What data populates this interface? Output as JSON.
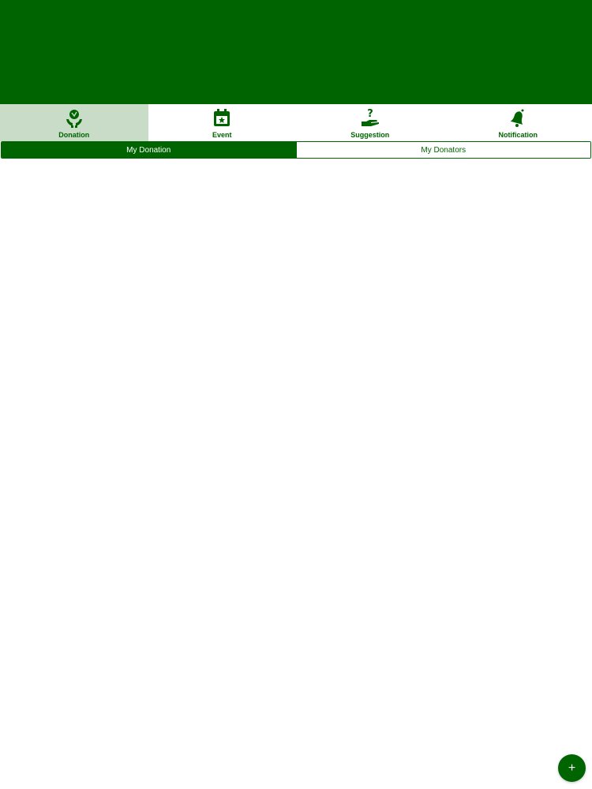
{
  "colors": {
    "primary": "#006400",
    "tab_active_bg": "#c8dcc8",
    "background": "#ffffff"
  },
  "tabs": [
    {
      "label": "Donation",
      "icon": "donation-hands-icon",
      "active": true
    },
    {
      "label": "Event",
      "icon": "calendar-star-icon",
      "active": false
    },
    {
      "label": "Suggestion",
      "icon": "question-hand-icon",
      "active": false
    },
    {
      "label": "Notification",
      "icon": "bell-icon",
      "active": false
    }
  ],
  "segment": {
    "left": "My Donation",
    "right": "My Donators",
    "selected": "My Donation"
  },
  "fab": {
    "symbol": "+",
    "icon": "plus-icon"
  }
}
